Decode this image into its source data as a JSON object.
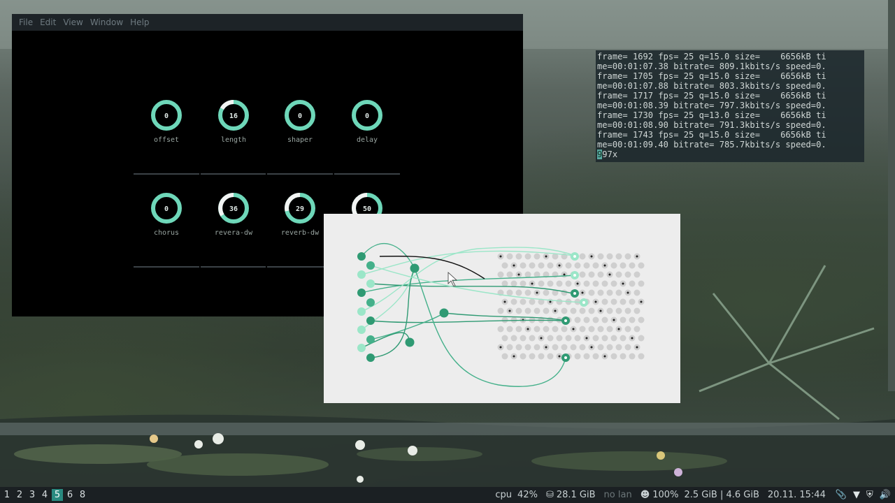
{
  "colors": {
    "accent": "#6ed7b9",
    "dark_node": "#2f9a73",
    "mid_node": "#44b08a",
    "light_node": "#9be6c8",
    "ws_active": "#2a8a80"
  },
  "synth_window": {
    "menu": [
      "File",
      "Edit",
      "View",
      "Window",
      "Help"
    ],
    "knobs_row1": [
      {
        "label": "offset",
        "value": "0",
        "fill": 0
      },
      {
        "label": "length",
        "value": "16",
        "fill": 0.16
      },
      {
        "label": "shaper",
        "value": "0",
        "fill": 0
      },
      {
        "label": "delay",
        "value": "0",
        "fill": 0
      }
    ],
    "knobs_row2": [
      {
        "label": "chorus",
        "value": "0",
        "fill": 0
      },
      {
        "label": "revera-dw",
        "value": "36",
        "fill": 0.36
      },
      {
        "label": "reverb-dw",
        "value": "29",
        "fill": 0.29
      },
      {
        "label": "",
        "value": "50",
        "fill": 0.5
      }
    ]
  },
  "terminal": {
    "lines": [
      "frame= 1692 fps= 25 q=15.0 size=    6656kB ti",
      "me=00:01:07.38 bitrate= 809.1kbits/s speed=0.",
      "frame= 1705 fps= 25 q=15.0 size=    6656kB ti",
      "me=00:01:07.88 bitrate= 803.3kbits/s speed=0.",
      "frame= 1717 fps= 25 q=15.0 size=    6656kB ti",
      "me=00:01:08.39 bitrate= 797.3kbits/s speed=0.",
      "frame= 1730 fps= 25 q=13.0 size=    6656kB ti",
      "me=00:01:08.90 bitrate= 791.3kbits/s speed=0.",
      "frame= 1743 fps= 25 q=15.0 size=    6656kB ti",
      "me=00:01:09.40 bitrate= 785.7kbits/s speed=0."
    ],
    "last_cursor": "9",
    "last_rest": "97x"
  },
  "taskbar": {
    "workspaces": [
      "1",
      "2",
      "3",
      "4",
      "5",
      "6",
      "8"
    ],
    "active_workspace": "5",
    "cpu_label": "cpu",
    "cpu_value": "42%",
    "disk": "28.1 GiB",
    "network": "no lan",
    "battery": "100%",
    "memory": "2.5 GiB | 4.6 GiB",
    "datetime": "20.11. 15:44",
    "tray_icons": [
      "paperclip-icon",
      "wifi-icon",
      "shield-icon",
      "volume-icon"
    ]
  }
}
